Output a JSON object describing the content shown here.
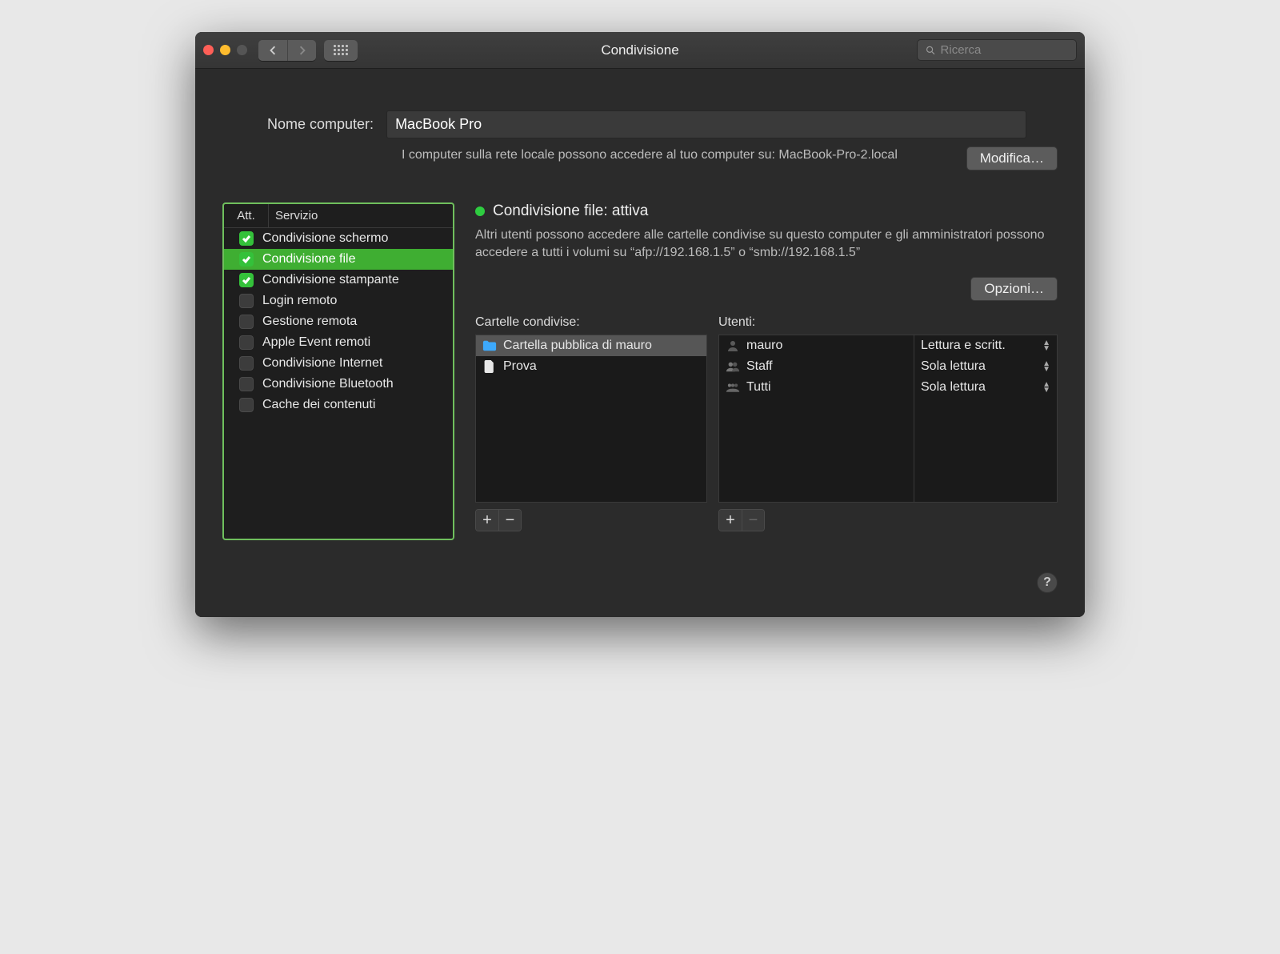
{
  "window": {
    "title": "Condivisione"
  },
  "search": {
    "placeholder": "Ricerca"
  },
  "computer_name": {
    "label": "Nome computer:",
    "value": "MacBook Pro",
    "subtext": "I computer sulla rete locale possono accedere al tuo computer su: MacBook-Pro-2.local",
    "edit_button": "Modifica…"
  },
  "services": {
    "col_active": "Att.",
    "col_service": "Servizio",
    "items": [
      {
        "label": "Condivisione schermo",
        "checked": true,
        "selected": false
      },
      {
        "label": "Condivisione file",
        "checked": true,
        "selected": true
      },
      {
        "label": "Condivisione stampante",
        "checked": true,
        "selected": false
      },
      {
        "label": "Login remoto",
        "checked": false,
        "selected": false
      },
      {
        "label": "Gestione remota",
        "checked": false,
        "selected": false
      },
      {
        "label": "Apple Event remoti",
        "checked": false,
        "selected": false
      },
      {
        "label": "Condivisione Internet",
        "checked": false,
        "selected": false
      },
      {
        "label": "Condivisione Bluetooth",
        "checked": false,
        "selected": false
      },
      {
        "label": "Cache dei contenuti",
        "checked": false,
        "selected": false
      }
    ]
  },
  "detail": {
    "status": "Condivisione file: attiva",
    "description": "Altri utenti possono accedere alle cartelle condivise su questo computer e gli amministratori possono accedere a tutti i volumi su “afp://192.168.1.5” o “smb://192.168.1.5”",
    "options_button": "Opzioni…",
    "folders_label": "Cartelle condivise:",
    "users_label": "Utenti:",
    "folders": [
      {
        "name": "Cartella pubblica di mauro",
        "icon": "folder-shared",
        "selected": true
      },
      {
        "name": "Prova",
        "icon": "file",
        "selected": false
      }
    ],
    "users": [
      {
        "name": "mauro",
        "icon": "user",
        "permission": "Lettura e scritt."
      },
      {
        "name": "Staff",
        "icon": "users",
        "permission": "Sola lettura"
      },
      {
        "name": "Tutti",
        "icon": "group",
        "permission": "Sola lettura"
      }
    ]
  }
}
